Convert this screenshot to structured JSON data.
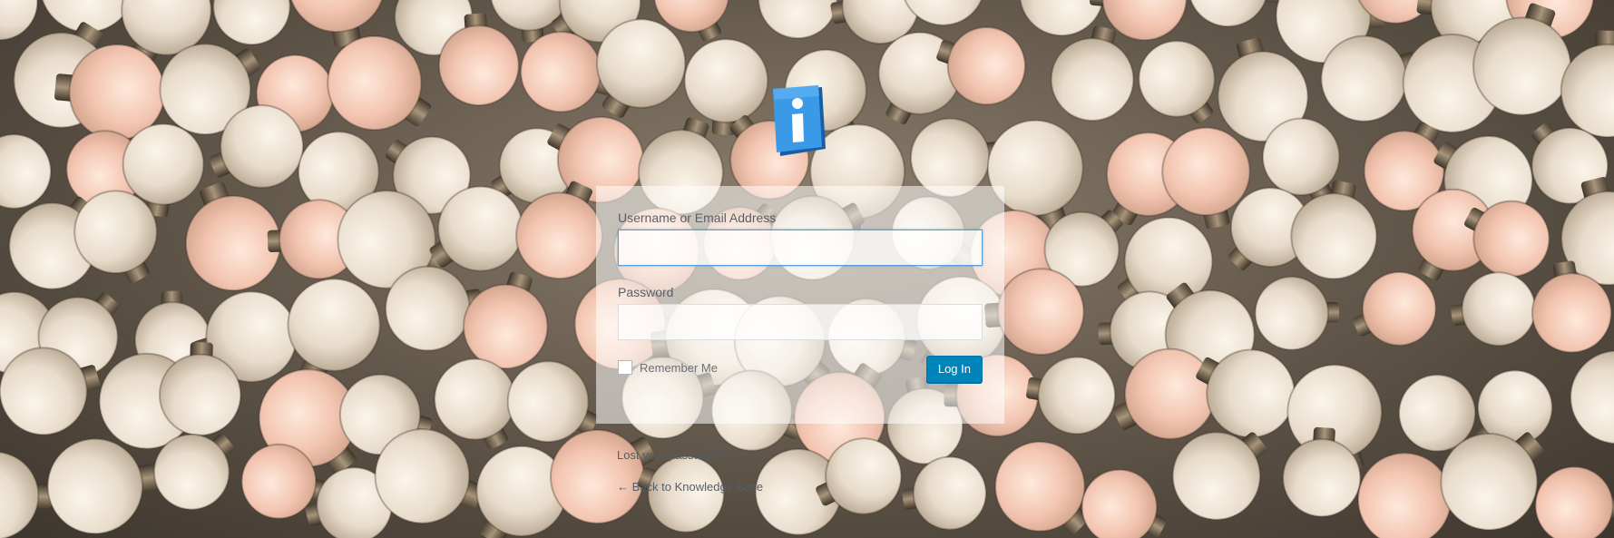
{
  "login_form": {
    "username_label": "Username or Email Address",
    "username_value": "",
    "password_label": "Password",
    "password_value": "",
    "remember_label": "Remember Me",
    "remember_checked": false,
    "login_button_label": "Log In"
  },
  "links": {
    "lost_password": "Lost your password?",
    "back_to_site": "← Back to Knowledge Base"
  },
  "logo": {
    "icon_name": "info-icon",
    "glyph": "i",
    "color": "#2e88d6"
  },
  "colors": {
    "accent": "#0085ba",
    "focus_border": "#5b9dd9"
  }
}
